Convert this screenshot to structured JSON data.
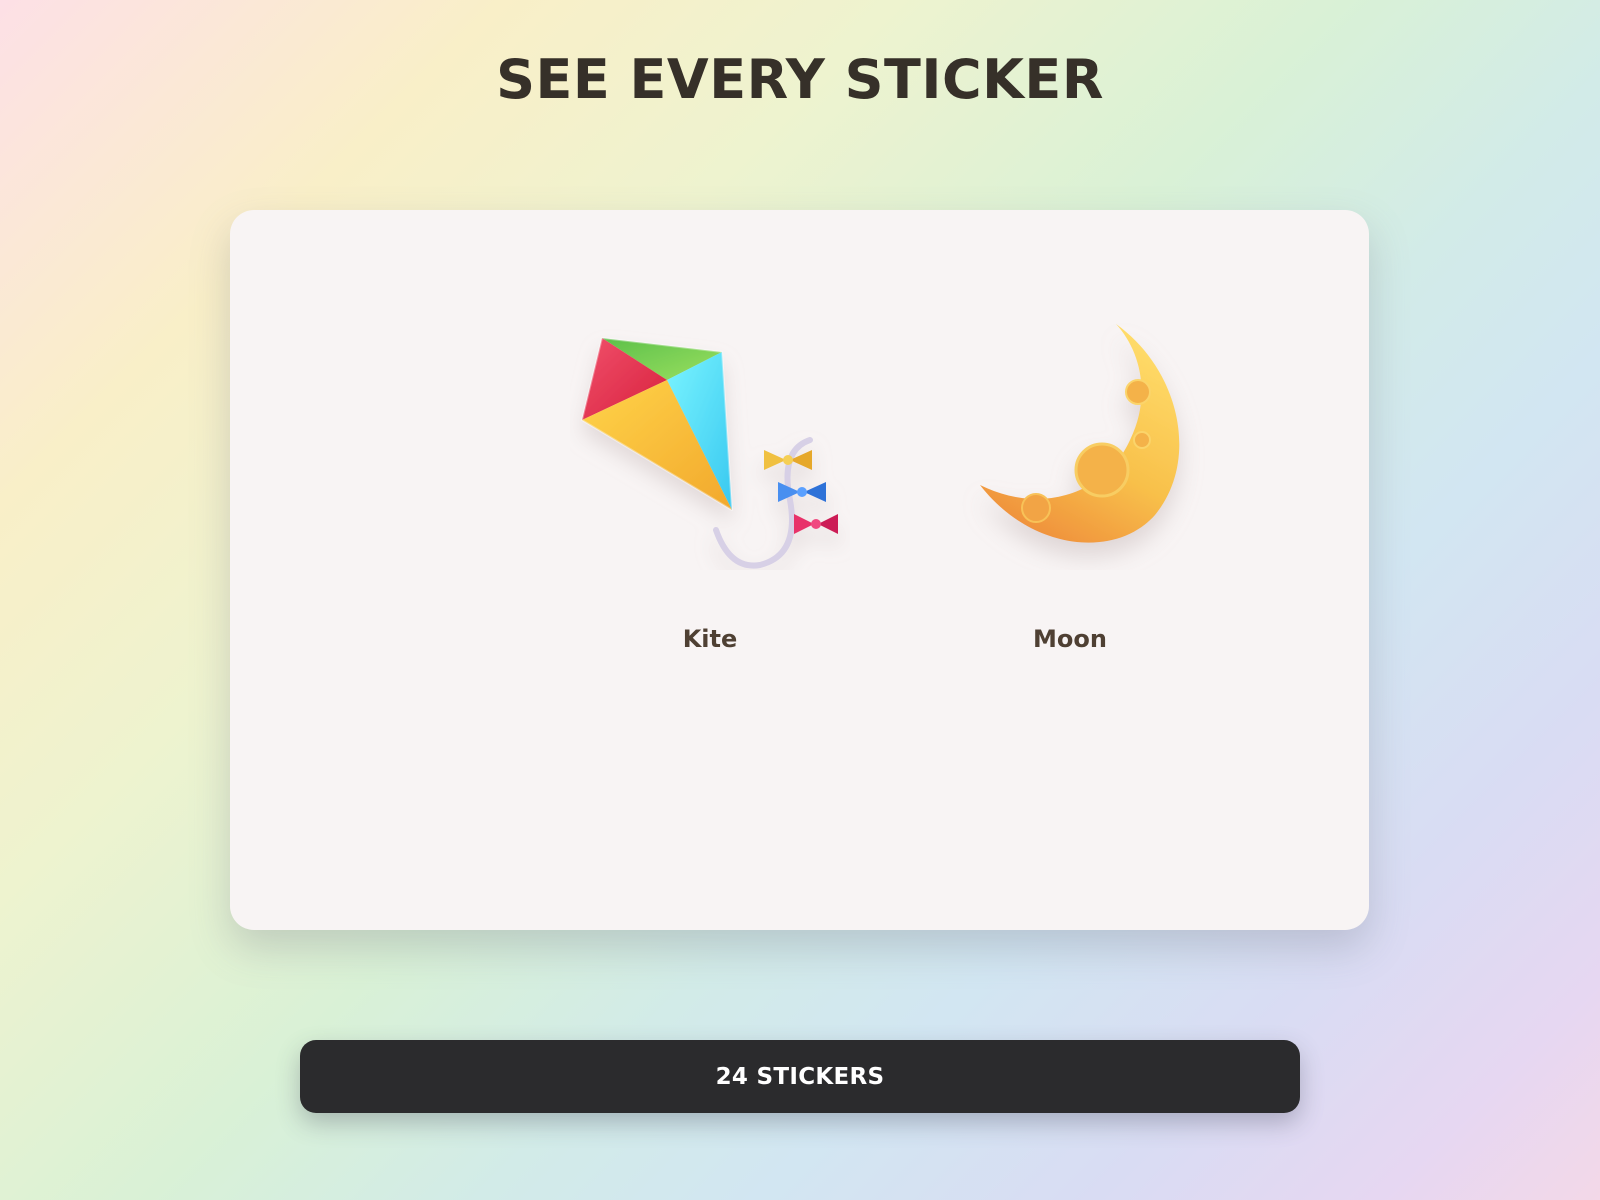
{
  "page": {
    "title": "SEE EVERY STICKER"
  },
  "stickers": [
    {
      "name": "Kite",
      "icon": "kite-icon"
    },
    {
      "name": "Moon",
      "icon": "crescent-moon-icon"
    }
  ],
  "footer": {
    "count_label": "24 STICKERS"
  },
  "colors": {
    "title_text": "#363029",
    "panel_background": "#f8f4f4",
    "label_text": "#4f4033",
    "button_background": "#2b2b2d",
    "button_text": "#ffffff"
  }
}
